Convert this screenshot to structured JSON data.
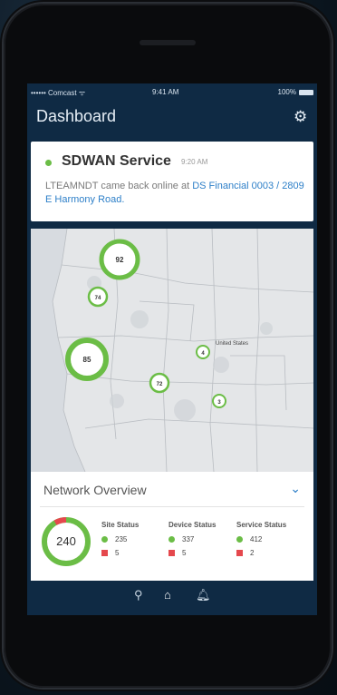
{
  "status": {
    "carrier": "•••••• Comcast ᯤ",
    "time": "9:41 AM",
    "battery": "100%"
  },
  "header": {
    "title": "Dashboard",
    "settings_icon": "gear-icon"
  },
  "notification": {
    "service": "SDWAN Service",
    "time": "9:20 AM",
    "message_prefix": "LTEAMNDT came back online at ",
    "message_link": "DS Financial 0003 / 2809 E Harmony Road."
  },
  "map": {
    "country_label": "United States",
    "sites": [
      {
        "label": "92"
      },
      {
        "label": "74"
      },
      {
        "label": "85"
      },
      {
        "label": "4"
      },
      {
        "label": "72"
      },
      {
        "label": "3"
      }
    ]
  },
  "overview": {
    "title": "Network Overview",
    "total": "240",
    "site": {
      "header": "Site Status",
      "ok": "235",
      "down": "5"
    },
    "device": {
      "header": "Device Status",
      "ok": "337",
      "down": "5"
    },
    "service": {
      "header": "Service Status",
      "ok": "412",
      "down": "2"
    }
  },
  "colors": {
    "ok": "#6bbd46",
    "down": "#e5484d",
    "navy": "#0f2a44",
    "link": "#2d7fc8"
  },
  "tabs": {
    "map_icon": "location-pin-icon",
    "home_icon": "home-icon",
    "alerts_icon": "bell-icon"
  }
}
